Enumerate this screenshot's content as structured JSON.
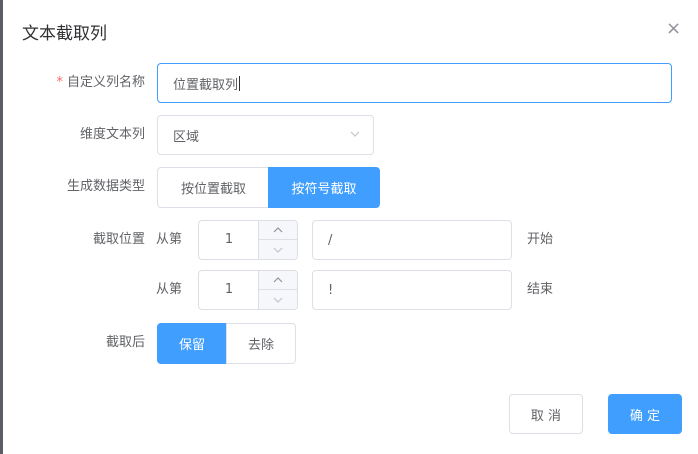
{
  "dialog": {
    "title": "文本截取列",
    "close_icon": "×"
  },
  "form": {
    "custom_name": {
      "required_mark": "*",
      "label": "自定义列名称",
      "value": "位置截取列"
    },
    "dimension": {
      "label": "维度文本列",
      "value": "区域",
      "arrow_icon": "chevron-down-icon"
    },
    "mode": {
      "label": "生成数据类型",
      "options": [
        "按位置截取",
        "按符号截取"
      ],
      "selected": "按符号截取"
    },
    "position": {
      "label": "截取位置",
      "start": {
        "prefix": "从第",
        "number": "1",
        "symbol": "/",
        "suffix": "开始"
      },
      "end": {
        "prefix": "从第",
        "number": "1",
        "symbol": "!",
        "suffix": "结束"
      }
    },
    "after": {
      "label": "截取后",
      "options": [
        "保留",
        "去除"
      ],
      "selected": "保留"
    }
  },
  "footer": {
    "cancel_label": "取 消",
    "confirm_label": "确 定"
  },
  "colors": {
    "primary": "#409eff",
    "required": "#f56c6c",
    "border": "#dcdfe6"
  }
}
